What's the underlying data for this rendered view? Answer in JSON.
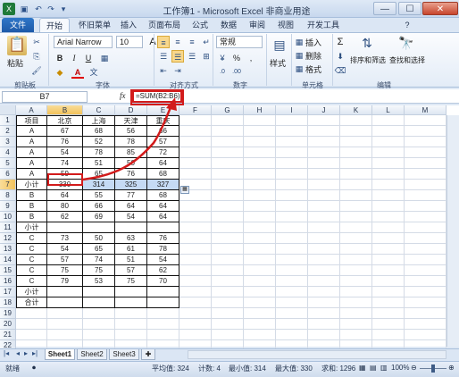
{
  "window": {
    "title": "工作簿1 - Microsoft Excel 非商业用途",
    "minimize": "—",
    "maximize": "☐",
    "close": "✕"
  },
  "ribbon_tabs": [
    "文件",
    "开始",
    "怀旧菜单",
    "插入",
    "页面布局",
    "公式",
    "数据",
    "审阅",
    "视图",
    "开发工具"
  ],
  "ribbon": {
    "paste_label": "粘贴",
    "font_name": "Arial Narrow",
    "font_size": "10",
    "bold": "B",
    "italic": "I",
    "underline": "U",
    "grow": "A",
    "shrink": "A",
    "number_format": "常规",
    "styles_label": "样式",
    "insert_label": "插入",
    "delete_label": "删除",
    "format_label": "格式",
    "sort_filter_label": "排序和筛选",
    "find_select_label": "查找和选择",
    "sum_symbol": "Σ",
    "percent": "%",
    "comma": ",",
    "groups": {
      "clipboard": "剪贴板",
      "font": "字体",
      "alignment": "对齐方式",
      "number": "数字",
      "cells": "单元格",
      "editing": "编辑"
    }
  },
  "formula_bar": {
    "cell_ref": "B7",
    "fx": "fx",
    "formula": "=SUM(B2:B6)"
  },
  "columns": [
    "A",
    "B",
    "C",
    "D",
    "E",
    "F",
    "G",
    "H",
    "I",
    "J",
    "K",
    "L",
    "M"
  ],
  "rows": [
    "1",
    "2",
    "3",
    "4",
    "5",
    "6",
    "7",
    "8",
    "9",
    "10",
    "11",
    "12",
    "13",
    "14",
    "15",
    "16",
    "17",
    "18",
    "19",
    "20",
    "21",
    "22"
  ],
  "table": [
    [
      "项目",
      "北京",
      "上海",
      "天津",
      "重庆"
    ],
    [
      "A",
      "67",
      "68",
      "56",
      "66"
    ],
    [
      "A",
      "76",
      "52",
      "78",
      "57"
    ],
    [
      "A",
      "54",
      "78",
      "85",
      "72"
    ],
    [
      "A",
      "74",
      "51",
      "50",
      "64"
    ],
    [
      "A",
      "59",
      "65",
      "76",
      "68"
    ],
    [
      "小计",
      "330",
      "314",
      "325",
      "327"
    ],
    [
      "B",
      "64",
      "55",
      "77",
      "68"
    ],
    [
      "B",
      "80",
      "66",
      "64",
      "64"
    ],
    [
      "B",
      "62",
      "69",
      "54",
      "64"
    ],
    [
      "小计",
      "",
      "",
      "",
      ""
    ],
    [
      "C",
      "73",
      "50",
      "63",
      "76"
    ],
    [
      "C",
      "54",
      "65",
      "61",
      "78"
    ],
    [
      "C",
      "57",
      "74",
      "51",
      "54"
    ],
    [
      "C",
      "75",
      "75",
      "57",
      "62"
    ],
    [
      "C",
      "79",
      "53",
      "75",
      "70"
    ],
    [
      "小计",
      "",
      "",
      "",
      ""
    ],
    [
      "合计",
      "",
      "",
      "",
      ""
    ]
  ],
  "sheet_tabs": [
    "Sheet1",
    "Sheet2",
    "Sheet3"
  ],
  "status": {
    "ready": "就绪",
    "average": "平均值: 324",
    "count": "计数: 4",
    "min": "最小值: 314",
    "max": "最大值: 330",
    "sum": "求和: 1296",
    "zoom": "100%"
  },
  "colors": {
    "selection": "#c5daf4",
    "highlight": "#d21b1b",
    "file_tab": "#1d59a8"
  }
}
